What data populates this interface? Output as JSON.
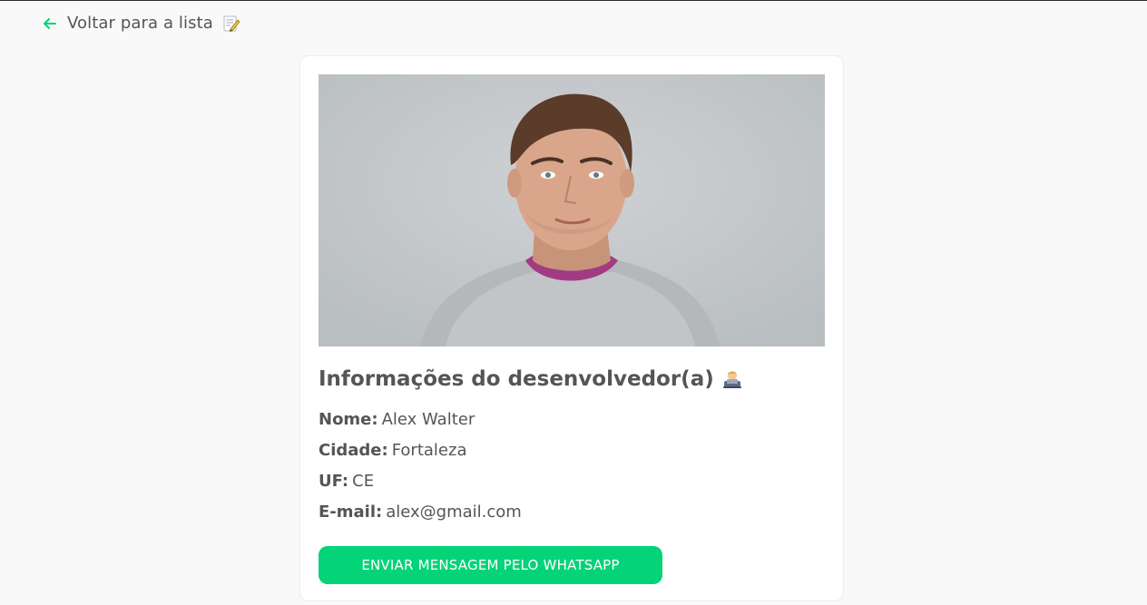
{
  "header": {
    "back_label": "Voltar para a lista",
    "back_icon": "arrow-left-icon",
    "note_icon": "memo-icon"
  },
  "profile": {
    "photo_alt": "Alex Walter",
    "section_title": "Informações do desenvolvedor(a)",
    "section_icon": "technologist-icon",
    "fields": {
      "name_label": "Nome:",
      "name_value": "Alex Walter",
      "city_label": "Cidade:",
      "city_value": "Fortaleza",
      "uf_label": "UF:",
      "uf_value": "CE",
      "email_label": "E-mail:",
      "email_value": "alex@gmail.com"
    },
    "whatsapp_button_label": "ENVIAR MENSAGEM PELO WHATSAPP"
  },
  "colors": {
    "accent": "#04d377",
    "text": "#555555",
    "background": "#f9f9f9",
    "card": "#ffffff"
  }
}
